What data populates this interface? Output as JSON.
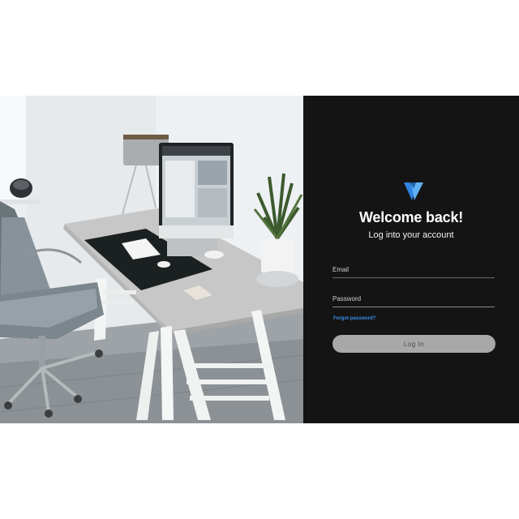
{
  "login": {
    "logo_icon": "brand-v-logo-icon",
    "title": "Welcome back!",
    "subtitle": "Log into your account",
    "email_placeholder": "Email",
    "email_value": "",
    "password_placeholder": "Password",
    "password_value": "",
    "forgot_label": "Forgot password?",
    "login_label": "Log In"
  },
  "colors": {
    "panel_bg": "#141414",
    "accent": "#3b8ee8",
    "button_bg": "#a8a8a8"
  },
  "photo": {
    "description_icon": "workspace-photo"
  }
}
